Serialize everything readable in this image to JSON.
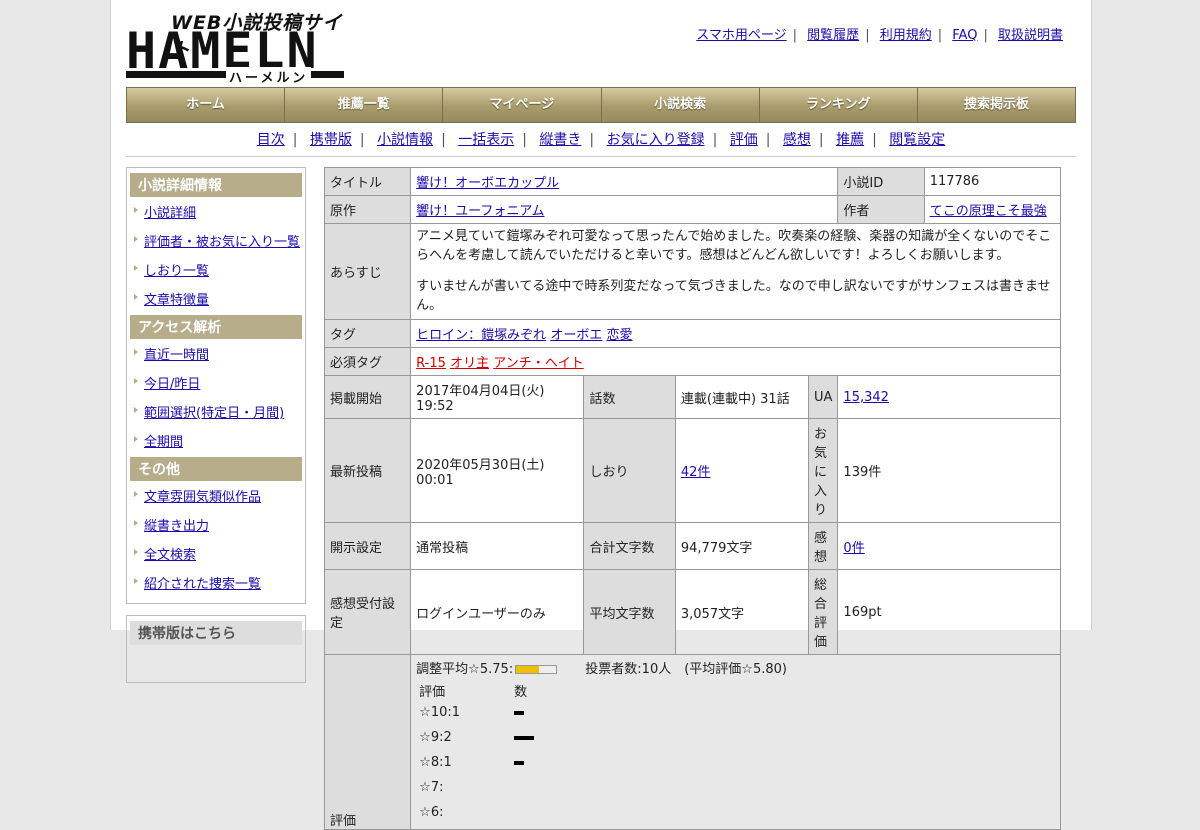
{
  "site": {
    "logo_tagline": "WEB小説投稿サイト",
    "logo_name": "HAMELN",
    "logo_kana": "ハーメルン"
  },
  "top_links": [
    "スマホ用ページ",
    "閲覧履歴",
    "利用規約",
    "FAQ",
    "取扱説明書"
  ],
  "main_nav": [
    "ホーム",
    "推薦一覧",
    "マイページ",
    "小説検索",
    "ランキング",
    "捜索掲示板"
  ],
  "sub_nav": [
    "目次",
    "携帯版",
    "小説情報",
    "一括表示",
    "縦書き",
    "お気に入り登録",
    "評価",
    "感想",
    "推薦",
    "閲覧設定"
  ],
  "sidebar": {
    "sections": [
      {
        "title": "小説詳細情報",
        "items": [
          "小説詳細",
          "評価者・被お気に入り一覧",
          "しおり一覧",
          "文章特徴量"
        ]
      },
      {
        "title": "アクセス解析",
        "items": [
          "直近一時間",
          "今日/昨日",
          "範囲選択(特定日・月間)",
          "全期間"
        ]
      },
      {
        "title": "その他",
        "items": [
          "文章雰囲気類似作品",
          "縦書き出力",
          "全文検索",
          "紹介された捜索一覧"
        ]
      }
    ],
    "mobile_title": "携帯版はこちら"
  },
  "novel": {
    "labels": {
      "title": "タイトル",
      "novel_id": "小説ID",
      "original": "原作",
      "author": "作者",
      "synopsis": "あらすじ",
      "tags": "タグ",
      "required_tags": "必須タグ",
      "published": "掲載開始",
      "episodes": "話数",
      "ua": "UA",
      "latest": "最新投稿",
      "bookmarks": "しおり",
      "favorites": "お気に入り",
      "visibility": "開示設定",
      "total_chars": "合計文字数",
      "reviews": "感想",
      "review_setting": "感想受付設定",
      "avg_chars": "平均文字数",
      "total_eval": "総合評価",
      "rating": "評価"
    },
    "title": "響け！オーボエカップル",
    "novel_id": "117786",
    "original": "響け！ユーフォニアム",
    "author": "てこの原理こそ最強",
    "synopsis_1": "アニメ見ていて鎧塚みぞれ可愛なって思ったんで始めました。吹奏楽の経験、楽器の知識が全くないのでそこらへんを考慮して読んでいただけると幸いです。感想はどんどん欲しいです！よろしくお願いします。",
    "synopsis_2": "すいませんが書いてる途中で時系列変だなって気づきました。なので申し訳ないですがサンフェスは書きません。",
    "tags": [
      "ヒロイン：鎧塚みぞれ",
      "オーボエ",
      "恋愛"
    ],
    "required_tags": [
      "R-15",
      "オリ主",
      "アンチ・ヘイト"
    ],
    "published": "2017年04月04日(火) 19:52",
    "episodes": "連載(連載中) 31話",
    "ua": "15,342",
    "latest": "2020年05月30日(土) 00:01",
    "bookmarks": "42件",
    "favorites": "139件",
    "visibility": "通常投稿",
    "total_chars": "94,779文字",
    "reviews": "0件",
    "review_setting": "ログインユーザーのみ",
    "avg_chars": "3,057文字",
    "total_eval": "169pt"
  },
  "rating": {
    "adjusted_avg": "調整平均☆5.75:",
    "meter_fraction": 0.575,
    "voters": "投票者数:10人　(平均評価☆5.80)",
    "head_rating": "評価",
    "head_count": "数",
    "rows": [
      {
        "label": "☆10:1",
        "count": 1
      },
      {
        "label": "☆9:2",
        "count": 2
      },
      {
        "label": "☆8:1",
        "count": 1
      },
      {
        "label": "☆7:",
        "count": 0
      },
      {
        "label": "☆6:",
        "count": 0
      }
    ]
  }
}
